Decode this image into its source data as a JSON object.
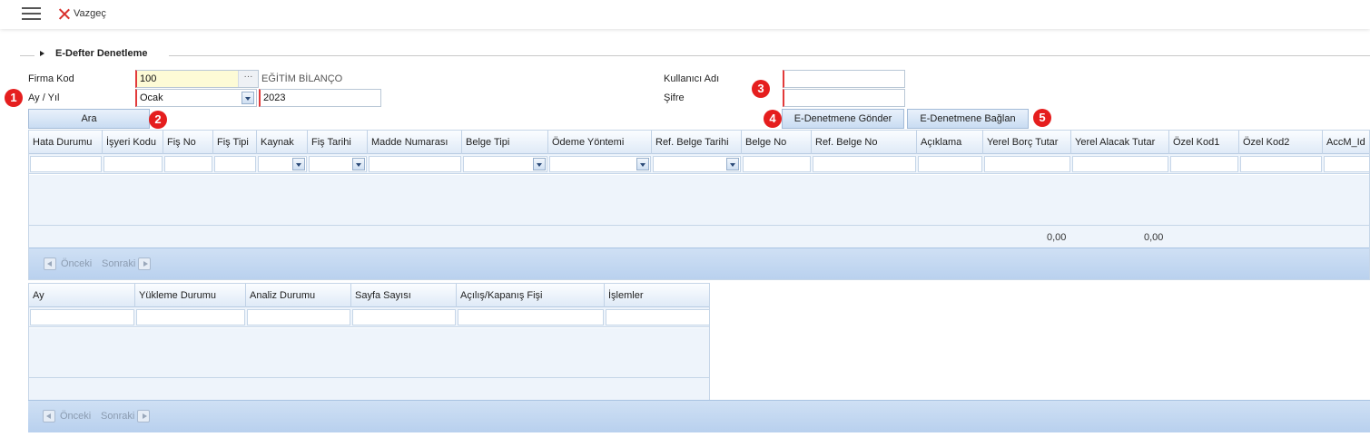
{
  "topbar": {
    "cancel_label": "Vazgeç"
  },
  "section": {
    "title": "E-Defter Denetleme"
  },
  "form": {
    "firma_kod_label": "Firma Kod",
    "firma_kod_value": "100",
    "firma_name": "EĞİTİM BİLANÇO",
    "ay_yil_label": "Ay / Yıl",
    "ay_value": "Ocak",
    "yil_value": "2023",
    "kullanici_label": "Kullanıcı Adı",
    "kullanici_value": "",
    "sifre_label": "Şifre",
    "sifre_value": ""
  },
  "buttons": {
    "ara": "Ara",
    "gonder": "E-Denetmene Gönder",
    "baglan": "E-Denetmene Bağlan"
  },
  "badges": [
    "1",
    "2",
    "3",
    "4",
    "5"
  ],
  "grid1": {
    "columns": [
      "Hata Durumu",
      "İşyeri Kodu",
      "Fiş No",
      "Fiş Tipi",
      "Kaynak",
      "Fiş Tarihi",
      "Madde Numarası",
      "Belge Tipi",
      "Ödeme Yöntemi",
      "Ref. Belge Tarihi",
      "Belge No",
      "Ref. Belge No",
      "Açıklama",
      "Yerel Borç Tutar",
      "Yerel Alacak Tutar",
      "Özel Kod1",
      "Özel Kod2",
      "AccM_Id"
    ],
    "summary": {
      "borc": "0,00",
      "alacak": "0,00"
    },
    "pager": {
      "prev": "Önceki",
      "next": "Sonraki"
    }
  },
  "grid2": {
    "columns": [
      "Ay",
      "Yükleme Durumu",
      "Analiz Durumu",
      "Sayfa Sayısı",
      "Açılış/Kapanış Fişi",
      "İşlemler"
    ],
    "pager": {
      "prev": "Önceki",
      "next": "Sonraki"
    }
  },
  "colors": {
    "badge": "#e51e1e",
    "required": "#e23a3a",
    "header_bg": "#dfeaf7"
  },
  "icons": {
    "menu": "hamburger-icon",
    "cancel": "close-x-icon",
    "section": "triangle-right-icon"
  }
}
